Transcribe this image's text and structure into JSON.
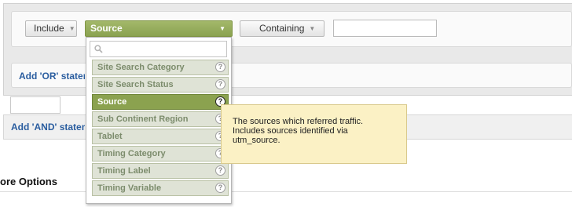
{
  "filter": {
    "include_label": "Include",
    "dimension_label": "Source",
    "match_label": "Containing",
    "value_input": ""
  },
  "links": {
    "add_or": "Add 'OR' statement",
    "add_and": "Add 'AND' statement"
  },
  "more_options": "ore Options",
  "dropdown": {
    "search_value": "",
    "items": [
      {
        "label": "Site Search Category"
      },
      {
        "label": "Site Search Status"
      },
      {
        "label": "Source"
      },
      {
        "label": "Sub Continent Region"
      },
      {
        "label": "Tablet"
      },
      {
        "label": "Timing Category"
      },
      {
        "label": "Timing Label"
      },
      {
        "label": "Timing Variable"
      }
    ],
    "selected_index": 2,
    "help_glyph": "?"
  },
  "tooltip": {
    "text_line1": "The sources which referred traffic.",
    "text_line2": "Includes sources identified via",
    "text_line3": "utm_source."
  },
  "icons": {
    "caret": "▼",
    "search": "search-icon",
    "help": "help-icon"
  },
  "colors": {
    "accent_green": "#8ba24f",
    "link_blue": "#2a5d9f",
    "tooltip_bg": "#fbf1c5"
  }
}
